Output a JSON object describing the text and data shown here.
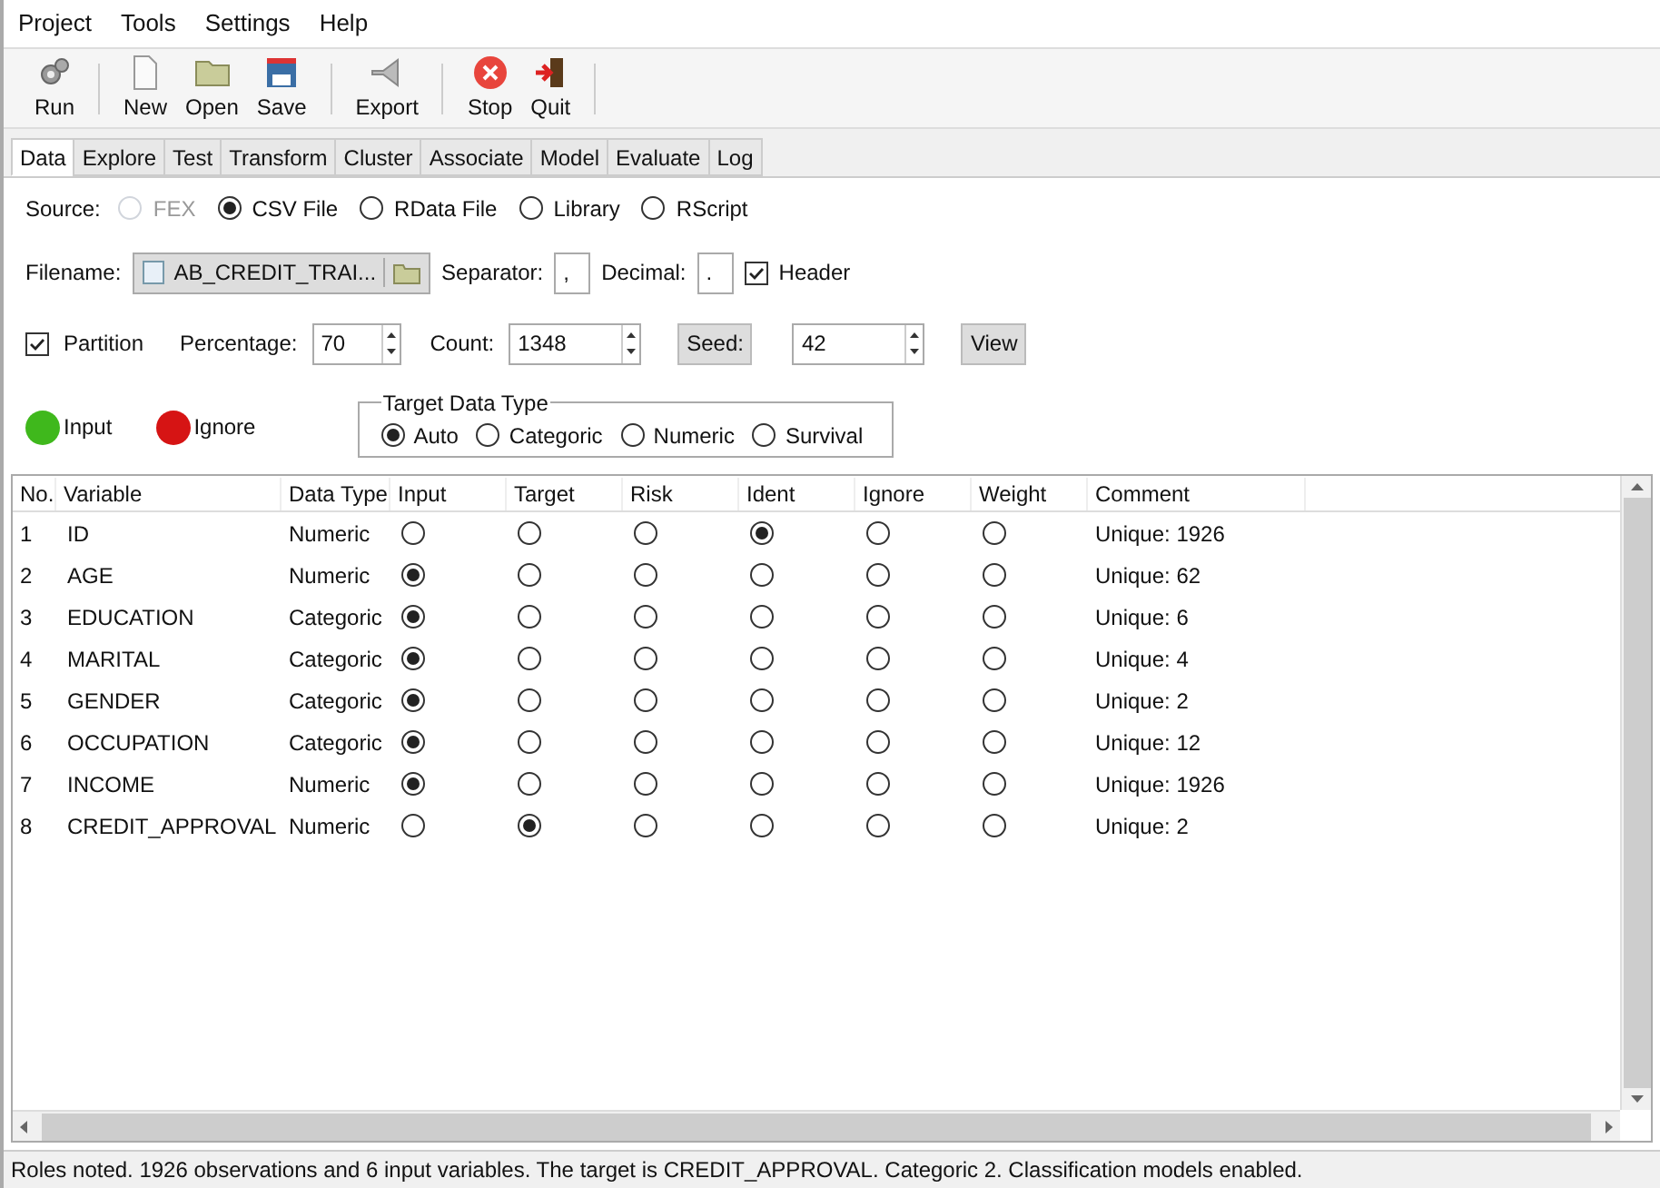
{
  "menu": [
    "Project",
    "Tools",
    "Settings",
    "Help"
  ],
  "toolbar": [
    {
      "label": "Run",
      "kind": "gear"
    },
    {
      "label": "New",
      "kind": "page",
      "sep": true
    },
    {
      "label": "Open",
      "kind": "folder"
    },
    {
      "label": "Save",
      "kind": "disk"
    },
    {
      "label": "Export",
      "kind": "export",
      "sep": true
    },
    {
      "label": "Stop",
      "kind": "stop",
      "sep": true
    },
    {
      "label": "Quit",
      "kind": "quit"
    }
  ],
  "tabs": [
    {
      "label": "Data",
      "selected": true
    },
    {
      "label": "Explore",
      "selected": false
    },
    {
      "label": "Test",
      "selected": false
    },
    {
      "label": "Transform",
      "selected": false
    },
    {
      "label": "Cluster",
      "selected": false
    },
    {
      "label": "Associate",
      "selected": false
    },
    {
      "label": "Model",
      "selected": false
    },
    {
      "label": "Evaluate",
      "selected": false
    },
    {
      "label": "Log",
      "selected": false
    }
  ],
  "source": {
    "label": "Source:",
    "options": [
      {
        "label": "FEX",
        "selected": false,
        "disabled": true
      },
      {
        "label": "CSV File",
        "selected": true,
        "disabled": false
      },
      {
        "label": "RData File",
        "selected": false,
        "disabled": false
      },
      {
        "label": "Library",
        "selected": false,
        "disabled": false
      },
      {
        "label": "RScript",
        "selected": false,
        "disabled": false
      }
    ]
  },
  "file": {
    "label": "Filename:",
    "value": "AB_CREDIT_TRAI...",
    "separator_label": "Separator:",
    "separator": ",",
    "decimal_label": "Decimal:",
    "decimal": ".",
    "header": {
      "label": "Header",
      "checked": true
    }
  },
  "partition": {
    "label": "Partition",
    "checked": true,
    "percentage_label": "Percentage:",
    "percentage": "70",
    "count_label": "Count:",
    "count": "1348",
    "seed_button": "Seed:",
    "seed": "42",
    "view_button": "View"
  },
  "legend": [
    {
      "label": "Input",
      "color": "#3fb81c"
    },
    {
      "label": "Ignore",
      "color": "#d61414"
    }
  ],
  "target_type": {
    "title": "Target Data Type",
    "options": [
      {
        "label": "Auto",
        "selected": true
      },
      {
        "label": "Categoric",
        "selected": false
      },
      {
        "label": "Numeric",
        "selected": false
      },
      {
        "label": "Survival",
        "selected": false
      }
    ]
  },
  "table": {
    "columns": [
      "No.",
      "Variable",
      "Data Type",
      "Input",
      "Target",
      "Risk",
      "Ident",
      "Ignore",
      "Weight",
      "Comment"
    ],
    "rows": [
      {
        "no": "1",
        "variable": "ID",
        "type": "Numeric",
        "roles": [
          {
            "selected": false
          },
          {
            "selected": false
          },
          {
            "selected": false
          },
          {
            "selected": true
          },
          {
            "selected": false
          },
          {
            "selected": false
          }
        ],
        "comment": "Unique: 1926"
      },
      {
        "no": "2",
        "variable": "AGE",
        "type": "Numeric",
        "roles": [
          {
            "selected": true
          },
          {
            "selected": false
          },
          {
            "selected": false
          },
          {
            "selected": false
          },
          {
            "selected": false
          },
          {
            "selected": false
          }
        ],
        "comment": "Unique: 62"
      },
      {
        "no": "3",
        "variable": "EDUCATION",
        "type": "Categoric",
        "roles": [
          {
            "selected": true
          },
          {
            "selected": false
          },
          {
            "selected": false
          },
          {
            "selected": false
          },
          {
            "selected": false
          },
          {
            "selected": false
          }
        ],
        "comment": "Unique: 6"
      },
      {
        "no": "4",
        "variable": "MARITAL",
        "type": "Categoric",
        "roles": [
          {
            "selected": true
          },
          {
            "selected": false
          },
          {
            "selected": false
          },
          {
            "selected": false
          },
          {
            "selected": false
          },
          {
            "selected": false
          }
        ],
        "comment": "Unique: 4"
      },
      {
        "no": "5",
        "variable": "GENDER",
        "type": "Categoric",
        "roles": [
          {
            "selected": true
          },
          {
            "selected": false
          },
          {
            "selected": false
          },
          {
            "selected": false
          },
          {
            "selected": false
          },
          {
            "selected": false
          }
        ],
        "comment": "Unique: 2"
      },
      {
        "no": "6",
        "variable": "OCCUPATION",
        "type": "Categoric",
        "roles": [
          {
            "selected": true
          },
          {
            "selected": false
          },
          {
            "selected": false
          },
          {
            "selected": false
          },
          {
            "selected": false
          },
          {
            "selected": false
          }
        ],
        "comment": "Unique: 12"
      },
      {
        "no": "7",
        "variable": "INCOME",
        "type": "Numeric",
        "roles": [
          {
            "selected": true
          },
          {
            "selected": false
          },
          {
            "selected": false
          },
          {
            "selected": false
          },
          {
            "selected": false
          },
          {
            "selected": false
          }
        ],
        "comment": "Unique: 1926"
      },
      {
        "no": "8",
        "variable": "CREDIT_APPROVAL",
        "type": "Numeric",
        "roles": [
          {
            "selected": false
          },
          {
            "selected": true
          },
          {
            "selected": false
          },
          {
            "selected": false
          },
          {
            "selected": false
          },
          {
            "selected": false
          }
        ],
        "comment": "Unique: 2"
      }
    ]
  },
  "status_bar": "Roles noted. 1926 observations and 6 input variables. The target is CREDIT_APPROVAL. Categoric 2. Classification models enabled."
}
